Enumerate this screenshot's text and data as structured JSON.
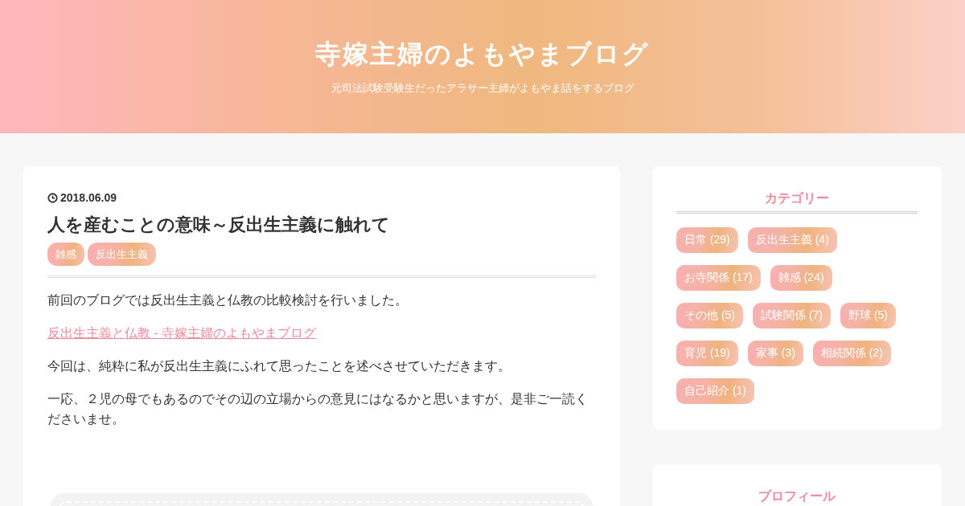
{
  "header": {
    "title": "寺嫁主婦のよもやまブログ",
    "tagline": "元司法試験受験生だったアラサー主婦がよもやま話をするブログ"
  },
  "article": {
    "date": "2018.06.09",
    "title": "人を産むことの意味～反出生主義に触れて",
    "tags": [
      "雑感",
      "反出生主義"
    ],
    "body": [
      {
        "kind": "text",
        "text": "前回のブログでは反出生主義と仏教の比較検討を行いました。"
      },
      {
        "kind": "link",
        "text": "反出生主義と仏教 - 寺嫁主婦のよもやまブログ"
      },
      {
        "kind": "text",
        "text": "今回は、純粋に私が反出生主義にふれて思ったことを述べさせていただきます。"
      },
      {
        "kind": "text",
        "text": "一応、２児の母でもあるのでその辺の立場からの意見にはなるかと思いますが、是非ご一読くださいませ。"
      }
    ]
  },
  "sidebar": [
    {
      "title": "カテゴリー",
      "categories": [
        "日常 (29)",
        "反出生主義 (4)",
        "お寺関係 (17)",
        "雑感 (24)",
        "その他 (5)",
        "試験関係 (7)",
        "野球 (5)",
        "育児 (19)",
        "家事 (3)",
        "相続関係 (2)",
        "自己紹介 (1)"
      ]
    },
    {
      "title": "プロフィール"
    }
  ]
}
